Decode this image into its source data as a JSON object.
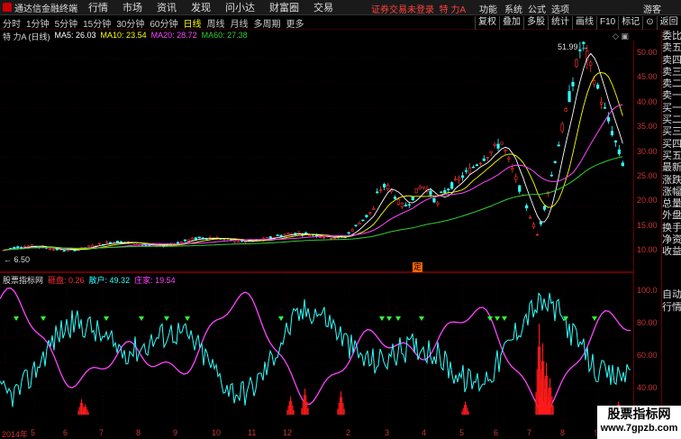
{
  "app": {
    "title": "通达信金融终端"
  },
  "menu": [
    "行情",
    "市场",
    "资讯",
    "发现",
    "问小达",
    "财富圈",
    "交易"
  ],
  "notice": "证券交易未登录",
  "stock_header": "特 力A",
  "top_right": [
    "功能",
    "系统",
    "公式",
    "选项",
    "游客"
  ],
  "periods": [
    {
      "label": "分时",
      "active": false
    },
    {
      "label": "1分钟",
      "active": false
    },
    {
      "label": "5分钟",
      "active": false
    },
    {
      "label": "15分钟",
      "active": false
    },
    {
      "label": "30分钟",
      "active": false
    },
    {
      "label": "60分钟",
      "active": false
    },
    {
      "label": "日线",
      "active": true
    },
    {
      "label": "周线",
      "active": false
    },
    {
      "label": "月线",
      "active": false
    },
    {
      "label": "多周期",
      "active": false
    },
    {
      "label": "更多",
      "active": false
    }
  ],
  "tools": [
    "复权",
    "叠加",
    "多股",
    "统计",
    "画线",
    "F10",
    "标记",
    "⊙",
    "返回"
  ],
  "ma": {
    "stock": "特 力A (日线)",
    "ma5": "MA5: 26.03",
    "ma10": "MA10: 23.54",
    "ma20": "MA20: 28.72",
    "ma60": "MA60: 27.38"
  },
  "panel_icons": "◇  ▣",
  "sidepanel": [
    "委比",
    "卖五",
    "卖四",
    "卖三",
    "卖二",
    "卖一",
    "买一",
    "买二",
    "买三",
    "买四",
    "买五",
    "最新",
    "涨跌",
    "涨幅",
    "总量",
    "外盘",
    "换手",
    "净资",
    "收益",
    "",
    "",
    "自动",
    "行情"
  ],
  "price_axis": [
    "50.00",
    "45.00",
    "40.00",
    "35.00",
    "30.00",
    "25.00",
    "20.00",
    "15.00",
    "10.00"
  ],
  "high_label": "51.99",
  "low_label": "6.50",
  "stamp": "定",
  "indicator": {
    "name": "股票指标网",
    "red_label": "砸盘: 0.26",
    "cyan_label": "散户: 49.32",
    "magenta_label": "庄家: 19.54"
  },
  "ind_axis": [
    "100.0",
    "80.00",
    "60.00",
    "40.00",
    "20.00"
  ],
  "x_axis": [
    "2014年",
    "5",
    "6",
    "7",
    "8",
    "9",
    "10",
    "11",
    "12",
    "2",
    "3",
    "4",
    "5",
    "6",
    "7",
    "8",
    "9"
  ],
  "watermark": {
    "line1": "股票指标网",
    "line2": "www.7gpzb.com"
  },
  "colors": {
    "up": "#ff3333",
    "down": "#33ffff",
    "ma5": "#ffffff",
    "ma10": "#ffff00",
    "ma20": "#ff44ff",
    "ma60": "#33cc33",
    "retail": "#33ffff",
    "dealer": "#ff44ff",
    "smash": "#ff1a1a"
  }
}
